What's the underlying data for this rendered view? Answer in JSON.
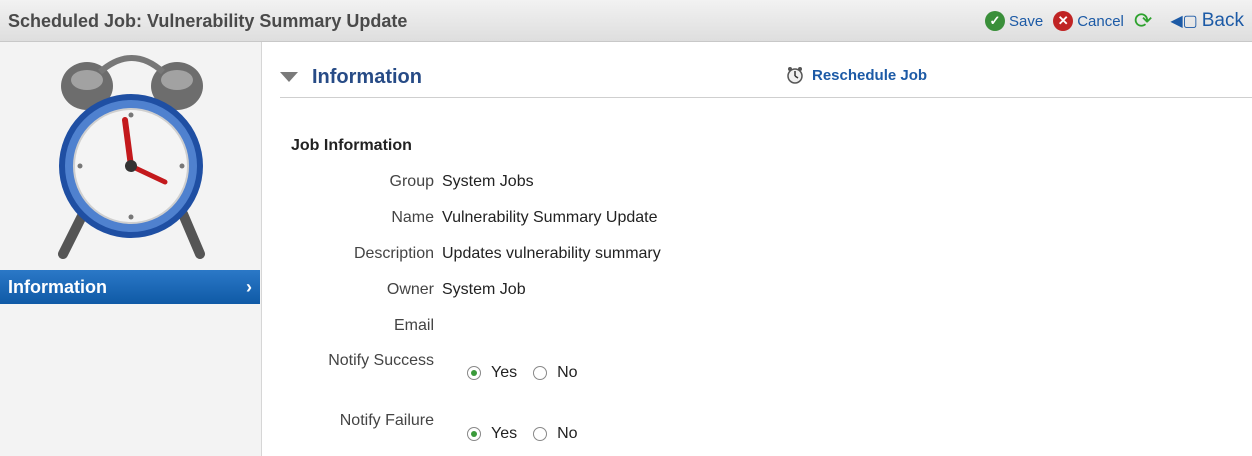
{
  "header": {
    "title": "Scheduled Job: Vulnerability Summary Update"
  },
  "toolbar": {
    "save_label": "Save",
    "cancel_label": "Cancel",
    "back_label": "Back",
    "icons": {
      "save": "check-circle-icon",
      "cancel": "x-circle-icon",
      "refresh": "refresh-icon",
      "back": "back-arrow-icon"
    }
  },
  "sidebar": {
    "image": "alarm-clock-icon",
    "items": [
      {
        "label": "Information",
        "selected": true
      }
    ]
  },
  "section": {
    "title": "Information",
    "reschedule_label": "Reschedule Job"
  },
  "job": {
    "heading": "Job Information",
    "fields": [
      {
        "label": "Group",
        "value": "System Jobs"
      },
      {
        "label": "Name",
        "value": "Vulnerability Summary Update"
      },
      {
        "label": "Description",
        "value": "Updates vulnerability summary"
      },
      {
        "label": "Owner",
        "value": "System Job"
      },
      {
        "label": "Email",
        "value": ""
      }
    ],
    "notify_success": {
      "label": "Notify Success",
      "yes_label": "Yes",
      "no_label": "No",
      "selected": "Yes"
    },
    "notify_failure": {
      "label": "Notify Failure",
      "yes_label": "Yes",
      "no_label": "No",
      "selected": "Yes"
    }
  },
  "colors": {
    "accent": "#1c5aa6",
    "sidebar_selected": "#1a64b4",
    "section_title": "#274b86"
  }
}
